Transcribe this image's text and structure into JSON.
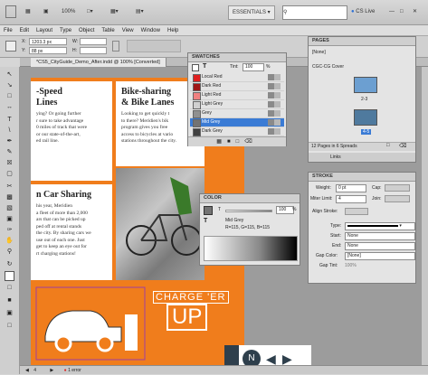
{
  "app_bar": {
    "zoom": "100%",
    "workspace": "ESSENTIALS",
    "cslive": "CS Live"
  },
  "menu": [
    "File",
    "Edit",
    "Layout",
    "Type",
    "Object",
    "Table",
    "View",
    "Window",
    "Help"
  ],
  "control_bar": {
    "x_label": "X:",
    "x_value": "1203.3 px",
    "y_label": "Y:",
    "y_value": "88 px",
    "w_label": "W:",
    "h_label": "H:"
  },
  "document_tab": "*CS5_CityGuide_Demo_After.indd @ 100% [Converted]",
  "article": {
    "col1_heading": "-Speed\nLines",
    "col1_body": "ying? Or going further\nr sure to take advantage\n0 miles of track that were\nor our state-of-the-art,\ned rail line.",
    "col2_heading": "Bike-sharing\n& Bike Lanes",
    "col2_body": "Looking to get quickly t\nto there? Meridien's bik\nprogram gives you free\naccess to bicycles at vario\nstations throughout the city.",
    "car_heading": "n Car Sharing",
    "car_body": "his year, Meridien\na fleet of more than 2,000\nars that can be picked up\nped off at rental stands\nthe city. By sharing cars we\nuse out of each one. Just\nget to keep an eye out for\nrt charging stations!",
    "charge_text": "CHARGE 'ER",
    "up_text": "UP"
  },
  "swatches_panel": {
    "title": "SWATCHES",
    "tint_label": "Tint:",
    "tint_value": "100",
    "tint_unit": "%",
    "items": [
      {
        "name": "Local Red",
        "color": "#e02020"
      },
      {
        "name": "Dark Red",
        "color": "#a01515"
      },
      {
        "name": "Light Red",
        "color": "#f08080"
      },
      {
        "name": "Light Grey",
        "color": "#d0d0d0"
      },
      {
        "name": "Grey",
        "color": "#909090"
      },
      {
        "name": "Mid Grey",
        "color": "#737373"
      },
      {
        "name": "Dark Grey",
        "color": "#404040"
      }
    ],
    "selected_index": 5
  },
  "pages_panel": {
    "title": "PAGES",
    "none_label": "[None]",
    "master_label": "CGC-CG Cover",
    "page_nums": [
      "2-3",
      "4-5"
    ],
    "status": "12 Pages in 6 Spreads"
  },
  "links_tab": "Links",
  "color_panel": {
    "title": "COLOR",
    "tint_label": "T",
    "tint_value": "100",
    "tint_unit": "%",
    "swatch_name": "Mid Grey",
    "rgb": "R=115, G=115, B=115"
  },
  "stroke_panel": {
    "title": "STROKE",
    "weight_label": "Weight:",
    "weight_value": "0 pt",
    "cap_label": "Cap:",
    "miter_label": "Miter Limit:",
    "miter_value": "4",
    "join_label": "Join:",
    "align_label": "Align Stroke:",
    "type_label": "Type:",
    "start_label": "Start:",
    "start_value": "None",
    "end_label": "End:",
    "end_value": "None",
    "gapcolor_label": "Gap Color:",
    "gapcolor_value": "[None]",
    "gaptint_label": "Gap Tint:",
    "gaptint_value": "100%"
  },
  "status_bar": {
    "page": "4",
    "errors": "1 error"
  },
  "colors": {
    "orange": "#f07d1c",
    "purple_guide": "#a040a0",
    "panel_select": "#3a7bd5"
  }
}
